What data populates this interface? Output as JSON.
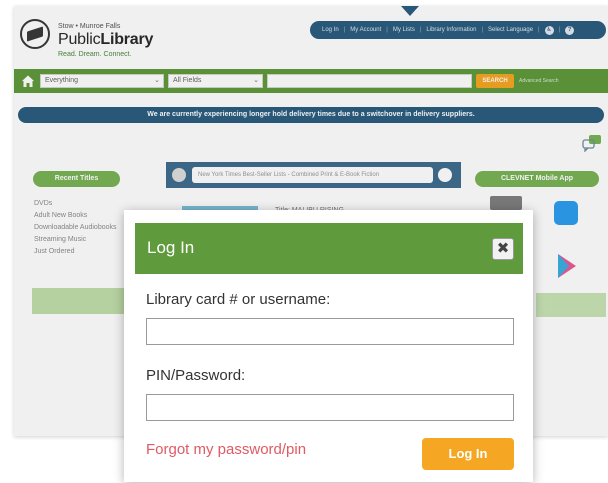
{
  "header": {
    "logo_small": "Stow • Munroe Falls",
    "logo_main_light": "Public",
    "logo_main_bold": "Library",
    "logo_tagline": "Read. Dream. Connect.",
    "nav": [
      "Log In",
      "My Account",
      "My Lists",
      "Library Information",
      "Select Language"
    ]
  },
  "search": {
    "scope": "Everything",
    "field": "All Fields",
    "query": "",
    "button": "SEARCH",
    "advanced": "Advanced Search"
  },
  "announcement": "We are currently experiencing longer hold delivery times due to a switchover in delivery suppliers.",
  "sidebar": {
    "heading": "Recent Titles",
    "items": [
      "DVDs",
      "Adult New Books",
      "Downloadable Audiobooks",
      "Streaming Music",
      "Just Ordered"
    ]
  },
  "lists": {
    "selected": "New York Times Best-Seller Lists - Combined Print & E-Book Fiction",
    "book_title": "Title: MALIBU RISING"
  },
  "mobile": {
    "heading": "CLEVNET Mobile App"
  },
  "modal": {
    "title": "Log In",
    "close_symbol": "✖",
    "username_label": "Library card # or username:",
    "username_value": "",
    "password_label": "PIN/Password:",
    "password_value": "",
    "forgot_link": "Forgot my password/pin",
    "login_button": "Log In"
  },
  "colors": {
    "brand_green": "#5f9a3c",
    "nav_blue": "#2b5d80",
    "accent_orange": "#f5a623",
    "link_red": "#e05a63"
  }
}
